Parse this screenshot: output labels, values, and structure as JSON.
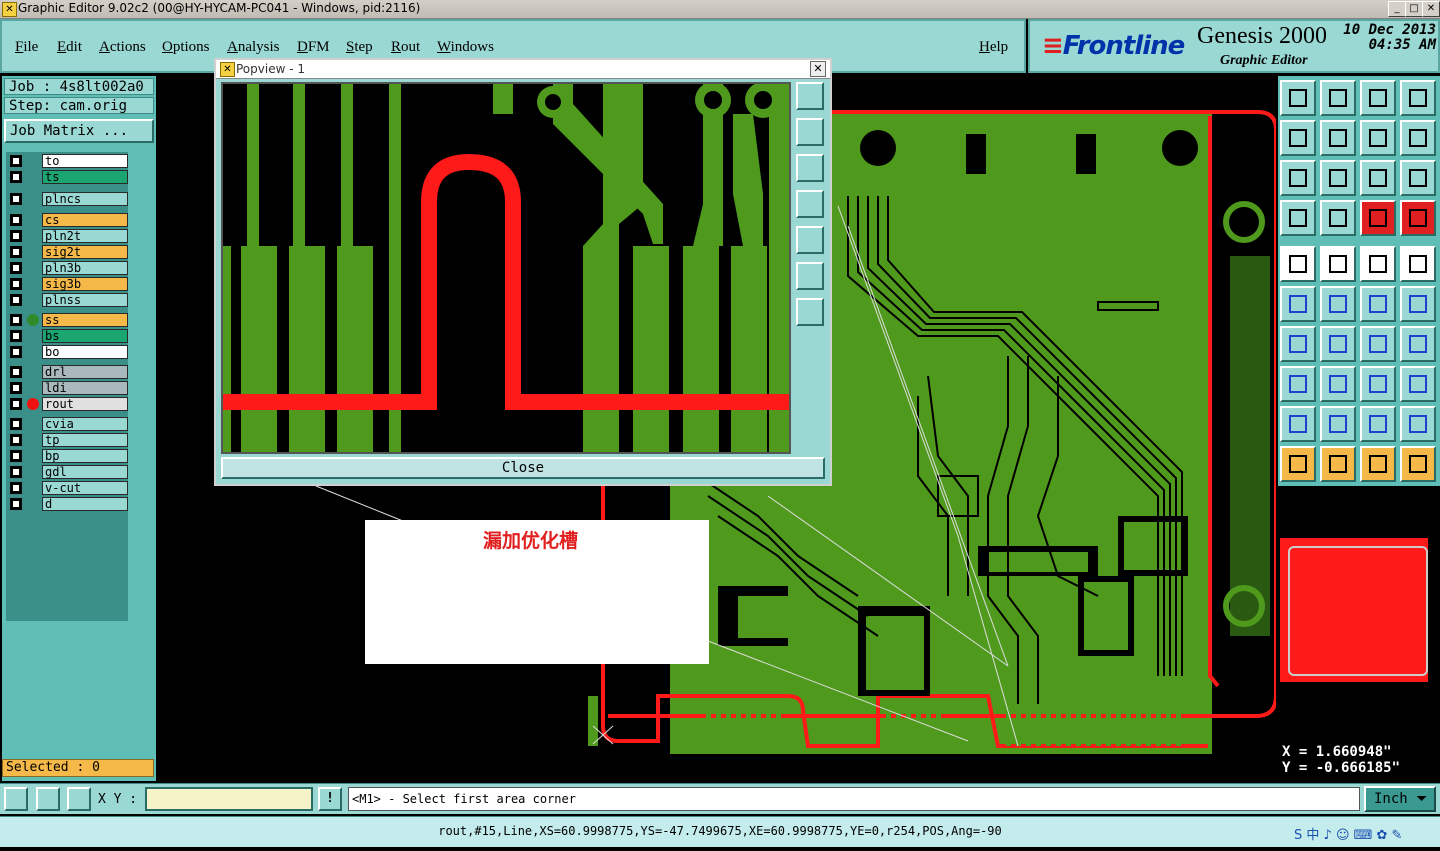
{
  "window": {
    "title": "Graphic Editor 9.02c2 (00@HY-HYCAM-PC041 - Windows, pid:2116)",
    "min": "_",
    "max": "□",
    "close": "✕"
  },
  "menu": [
    "File",
    "Edit",
    "Actions",
    "Options",
    "Analysis",
    "DFM",
    "Step",
    "Rout",
    "Windows"
  ],
  "help": "Help",
  "brand": {
    "logo": "Frontline",
    "product": "Genesis 2000",
    "subtitle": "Graphic Editor",
    "date_line1": "10 Dec 2013",
    "date_line2": "04:35 AM"
  },
  "job": {
    "job_label": "Job : 4s8lt002a0",
    "step_label": "Step: cam.orig",
    "matrix_button": "Job Matrix ..."
  },
  "layers": [
    {
      "name": "to",
      "color": "#ffffff",
      "dot": ""
    },
    {
      "name": "ts",
      "color": "#1aa571",
      "dot": ""
    },
    {
      "name": "plncs",
      "color": "#9ad8d4",
      "dot": ""
    },
    {
      "name": "cs",
      "color": "#f5b94a",
      "dot": ""
    },
    {
      "name": "pln2t",
      "color": "#9ad8d4",
      "dot": ""
    },
    {
      "name": "sig2t",
      "color": "#f5b94a",
      "dot": ""
    },
    {
      "name": "pln3b",
      "color": "#9ad8d4",
      "dot": ""
    },
    {
      "name": "sig3b",
      "color": "#f5b94a",
      "dot": ""
    },
    {
      "name": "plnss",
      "color": "#9ad8d4",
      "dot": ""
    },
    {
      "name": "ss",
      "color": "#f5b94a",
      "dot": "#2f8a2a"
    },
    {
      "name": "bs",
      "color": "#1aa571",
      "dot": ""
    },
    {
      "name": "bo",
      "color": "#ffffff",
      "dot": ""
    },
    {
      "name": "drl",
      "color": "#a8b8bc",
      "dot": ""
    },
    {
      "name": "ldi",
      "color": "#a8b8bc",
      "dot": ""
    },
    {
      "name": "rout",
      "color": "#e0e0e0",
      "dot": "#ee1111"
    },
    {
      "name": "cvia",
      "color": "#9ad8d4",
      "dot": ""
    },
    {
      "name": "tp",
      "color": "#9ad8d4",
      "dot": ""
    },
    {
      "name": "bp",
      "color": "#9ad8d4",
      "dot": ""
    },
    {
      "name": "gdl",
      "color": "#9ad8d4",
      "dot": ""
    },
    {
      "name": "v-cut",
      "color": "#9ad8d4",
      "dot": ""
    },
    {
      "name": "d",
      "color": "#9ad8d4",
      "dot": ""
    }
  ],
  "selected": "Selected : 0",
  "cmd": {
    "xy_label": "X Y :",
    "xy_value": "",
    "message": "<M1> - Select first area corner",
    "unit": "Inch",
    "alert": "!"
  },
  "status": "rout,#15,Line,XS=60.9998775,YS=-47.7499675,XE=60.9998775,YE=0,r254,POS,Ang=-90",
  "coords": {
    "x": "X =  1.660948\"",
    "y": "Y = -0.666185\""
  },
  "popview": {
    "title": "Popview - 1",
    "close": "Close"
  },
  "note": "漏加优化槽",
  "tray": "S 中 ♪ ☺ ⌨ ✿ ✎",
  "colors": {
    "pcb_green": "#4f9a1c",
    "rout_red": "#ff1a1a",
    "panel": "#9ad8d4"
  }
}
